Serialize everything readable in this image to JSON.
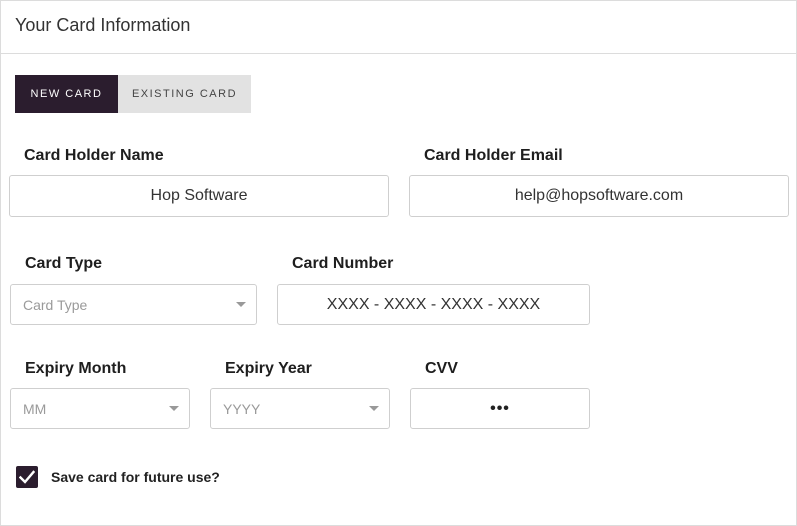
{
  "panel": {
    "title": "Your Card Information"
  },
  "tabs": [
    {
      "label": "NEW CARD",
      "active": true
    },
    {
      "label": "EXISTING CARD",
      "active": false
    }
  ],
  "form": {
    "holder_name": {
      "label": "Card Holder Name",
      "value": "Hop Software"
    },
    "holder_email": {
      "label": "Card Holder Email",
      "value": "help@hopsoftware.com"
    },
    "card_type": {
      "label": "Card Type",
      "placeholder": "Card Type"
    },
    "card_number": {
      "label": "Card Number",
      "value": "XXXX - XXXX - XXXX - XXXX"
    },
    "expiry_month": {
      "label": "Expiry Month",
      "placeholder": "MM"
    },
    "expiry_year": {
      "label": "Expiry Year",
      "placeholder": "YYYY"
    },
    "cvv": {
      "label": "CVV",
      "value": "•••"
    },
    "save_card": {
      "label": "Save card for future use?",
      "checked": true
    }
  },
  "colors": {
    "accent": "#2b1d2e",
    "tab_inactive": "#e2e2e2",
    "border": "#cfcfcf"
  },
  "icons": {
    "checkbox": "checkmark-icon",
    "dropdown": "caret-down-icon"
  }
}
